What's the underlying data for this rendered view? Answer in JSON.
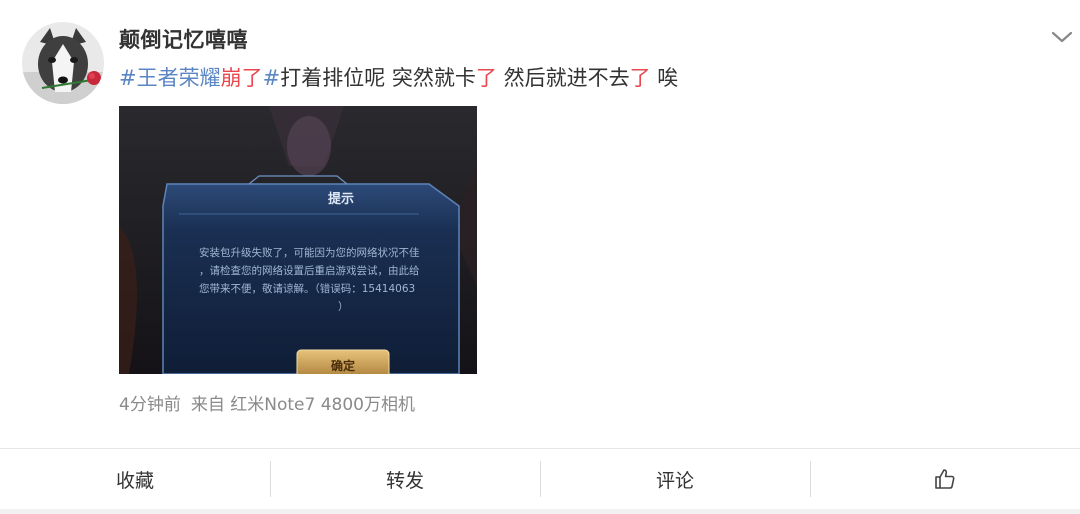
{
  "post": {
    "username": "颠倒记忆嘻嘻",
    "text": {
      "tag_open": "#王者荣耀",
      "tag_highlight": "崩了",
      "tag_close": "#",
      "part1": "打着排位呢 突然就卡",
      "hl1": "了",
      "part2": " 然后就进不去",
      "hl2": "了",
      "part3": " 唉"
    },
    "meta": {
      "time": "4分钟前",
      "source": "来自 红米Note7 4800万相机"
    }
  },
  "image": {
    "dialog_title": "提示",
    "dialog_lines": [
      "安装包升级失败了，可能因为您的网络状况不佳",
      "，请检查您的网络设置后重启游戏尝试，由此给",
      "您带来不便，敬请谅解。（错误码：15414063",
      "）"
    ],
    "confirm_label": "确定"
  },
  "actions": {
    "favorite": "收藏",
    "repost": "转发",
    "comment": "评论",
    "like_icon": "thumbs-up-icon"
  },
  "colors": {
    "tag": "#5b86c4",
    "highlight": "#e8474e",
    "meta": "#8a8a8a"
  }
}
